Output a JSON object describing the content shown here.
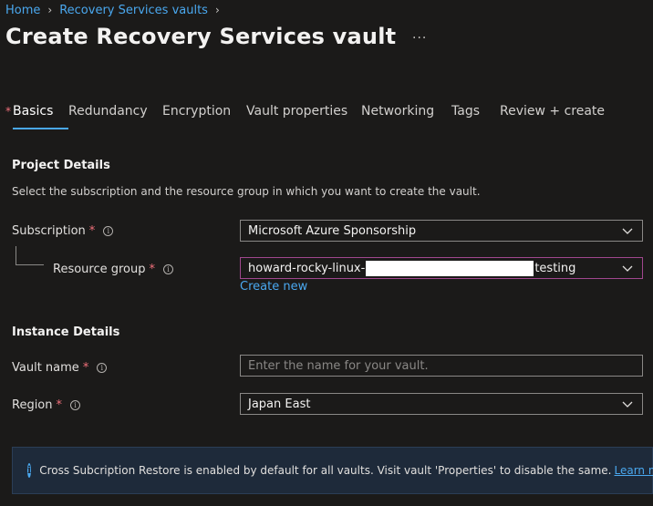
{
  "breadcrumb": {
    "items": [
      "Home",
      "Recovery Services vaults"
    ]
  },
  "page_title": "Create Recovery Services vault",
  "more_label": "...",
  "tabs": [
    {
      "label": "Basics",
      "required": "*"
    },
    {
      "label": "Redundancy"
    },
    {
      "label": "Encryption"
    },
    {
      "label": "Vault properties"
    },
    {
      "label": "Networking"
    },
    {
      "label": "Tags"
    },
    {
      "label": "Review + create"
    }
  ],
  "project": {
    "heading": "Project Details",
    "description": "Select the subscription and the resource group in which you want to create the vault.",
    "subscription_label": "Subscription",
    "subscription_value": "Microsoft Azure Sponsorship",
    "resource_group_label": "Resource group",
    "resource_group_prefix": "howard-rocky-linux-",
    "resource_group_suffix": "testing",
    "create_new": "Create new"
  },
  "instance": {
    "heading": "Instance Details",
    "vault_name_label": "Vault name",
    "vault_name_placeholder": "Enter the name for your vault.",
    "vault_name_value": "",
    "region_label": "Region",
    "region_value": "Japan East"
  },
  "required_mark": "*",
  "info_glyph": "i",
  "banner": {
    "text": "Cross Subcription Restore is enabled by default for all vaults. Visit vault 'Properties' to disable the same.",
    "link": "Learn more."
  },
  "colors": {
    "accent": "#4aa8ef",
    "required": "#f1707b",
    "focus_border": "#a0478e",
    "background": "#1b1a19"
  }
}
